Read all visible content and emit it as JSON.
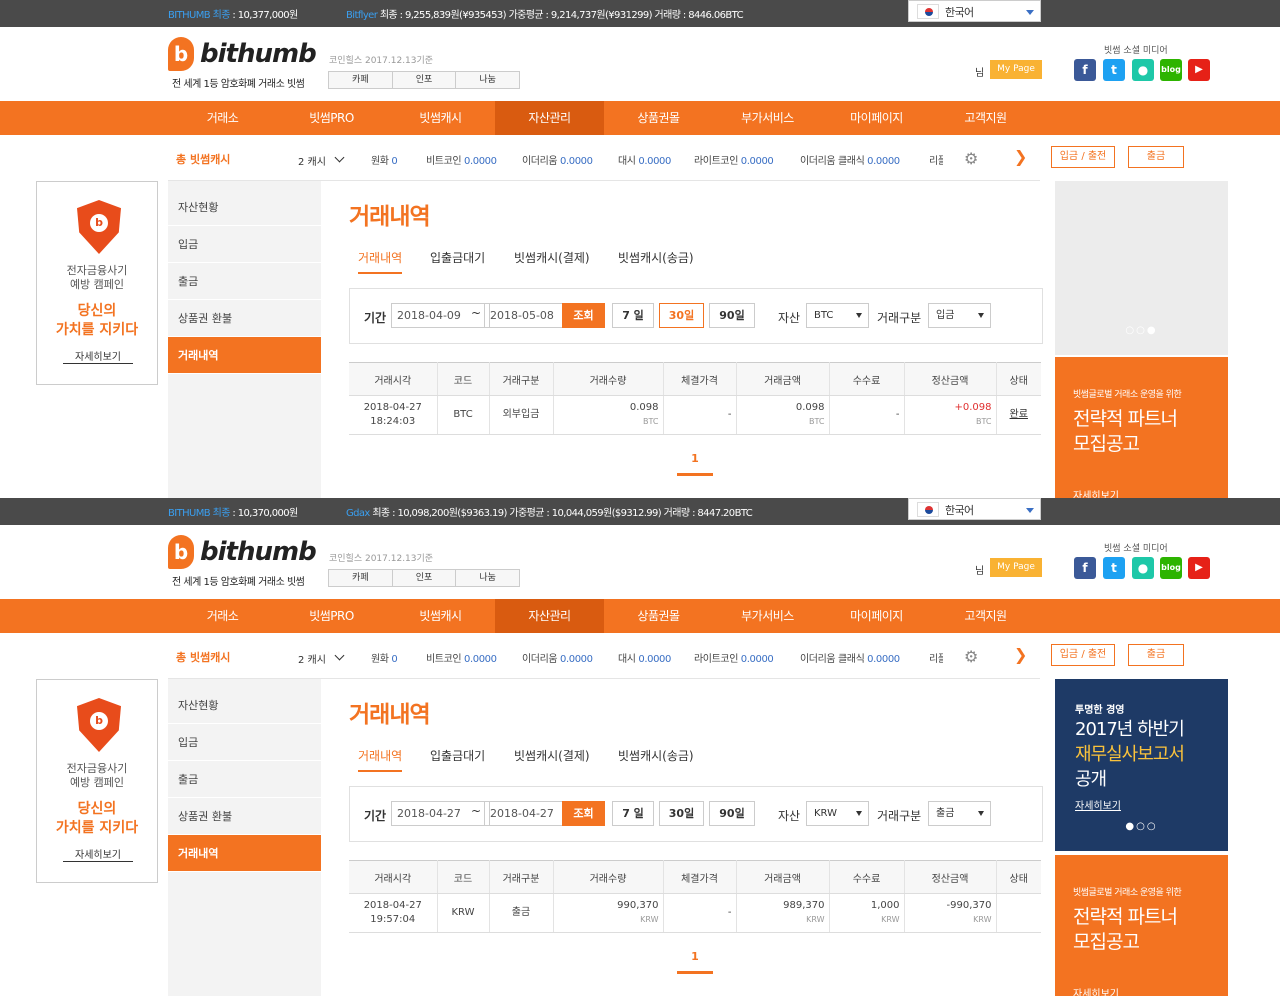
{
  "panels": [
    {
      "ticker": {
        "bithumb_label": "BITHUMB 최종",
        "bithumb_value": " : 10,377,000원",
        "exchange_label": "Bitflyer",
        "exchange_value": " 최종 : 9,255,839원(¥935453) 가중평균 : 9,214,737원(¥931299) 거래량 : 8446.06BTC"
      },
      "language": "한국어",
      "header": {
        "logo_mark": "b",
        "logo_text": "bithumb",
        "tagline": "전 세계 1등 암호화폐 거래소 빗썸",
        "coin_note": "코인힐스 2017.12.13기준",
        "small_tabs": [
          "카페",
          "인포",
          "나눔"
        ],
        "user_suffix": "님",
        "mypage": "My Page",
        "social_title": "빗썸 소셜 미디어"
      },
      "nav": [
        "거래소",
        "빗썸PRO",
        "빗썸캐시",
        "자산관리",
        "상품권몰",
        "부가서비스",
        "마이페이지",
        "고객지원"
      ],
      "subbar": {
        "total": "총 빗썸캐시",
        "cash": "2 캐시",
        "coins": [
          {
            "name": "원화",
            "val": "0"
          },
          {
            "name": "비트코인",
            "val": "0.0000"
          },
          {
            "name": "이더리움",
            "val": "0.0000"
          },
          {
            "name": "대시",
            "val": "0.0000"
          },
          {
            "name": "라이트코인",
            "val": "0.0000"
          },
          {
            "name": "이더리움 클래식",
            "val": "0.0000"
          },
          {
            "name": "리플",
            "val": ""
          }
        ],
        "deposit_btn": "입금 / 출전",
        "withdraw_btn": "출금"
      },
      "campaign": {
        "line1": "전자금융사기",
        "line2": "예방 캠페인",
        "line3": "당신의",
        "line4": "가치를 지키다",
        "more": "자세히보기"
      },
      "left_menu": [
        "자산현황",
        "입금",
        "출금",
        "상품권 환불",
        "거래내역"
      ],
      "page_title": "거래내역",
      "tabs": [
        "거래내역",
        "입출금대기",
        "빗썸캐시(결제)",
        "빗썸캐시(송금)"
      ],
      "filter": {
        "period_label": "기간",
        "date_from": "2018-04-09",
        "tilde": "~",
        "date_to": "2018-05-08",
        "search": "조회",
        "d7": "7 일",
        "d30": "30일",
        "d90": "90일",
        "asset_label": "자산",
        "asset": "BTC",
        "type_label": "거래구분",
        "type": "입금",
        "selected_range": "30일"
      },
      "table": {
        "headers": [
          "거래시각",
          "코드",
          "거래구분",
          "거래수량",
          "체결가격",
          "거래금액",
          "수수료",
          "정산금액",
          "상태"
        ],
        "row": {
          "date": "2018-04-27",
          "time": "18:24:03",
          "code": "BTC",
          "type": "외부입금",
          "qty": "0.098",
          "qty_unit": "BTC",
          "price": "-",
          "amount": "0.098",
          "amount_unit": "BTC",
          "fee": "-",
          "fee_unit": "",
          "settle": "+0.098",
          "settle_unit": "BTC",
          "status": "완료"
        }
      },
      "pager": "1",
      "banner_top": {
        "dots": "○○●"
      },
      "banner_bottom": {
        "small": "빗썸글로벌 거래소 운영을 위한",
        "line1": "전략적 파트너",
        "line2": "모집공고",
        "more": "자세히보기"
      }
    },
    {
      "ticker": {
        "bithumb_label": "BITHUMB 최종",
        "bithumb_value": " : 10,370,000원",
        "exchange_label": "Gdax",
        "exchange_value": " 최종 : 10,098,200원($9363.19) 가중평균 : 10,044,059원($9312.99) 거래량 : 8447.20BTC"
      },
      "language": "한국어",
      "header": {
        "logo_mark": "b",
        "logo_text": "bithumb",
        "tagline": "전 세계 1등 암호화폐 거래소 빗썸",
        "coin_note": "코인힐스 2017.12.13기준",
        "small_tabs": [
          "카페",
          "인포",
          "나눔"
        ],
        "user_suffix": "님",
        "mypage": "My Page",
        "social_title": "빗썸 소셜 미디어"
      },
      "nav": [
        "거래소",
        "빗썸PRO",
        "빗썸캐시",
        "자산관리",
        "상품권몰",
        "부가서비스",
        "마이페이지",
        "고객지원"
      ],
      "subbar": {
        "total": "총 빗썸캐시",
        "cash": "2 캐시",
        "coins": [
          {
            "name": "원화",
            "val": "0"
          },
          {
            "name": "비트코인",
            "val": "0.0000"
          },
          {
            "name": "이더리움",
            "val": "0.0000"
          },
          {
            "name": "대시",
            "val": "0.0000"
          },
          {
            "name": "라이트코인",
            "val": "0.0000"
          },
          {
            "name": "이더리움 클래식",
            "val": "0.0000"
          },
          {
            "name": "리플",
            "val": ""
          }
        ],
        "deposit_btn": "입금 / 출전",
        "withdraw_btn": "출금"
      },
      "campaign": {
        "line1": "전자금융사기",
        "line2": "예방 캠페인",
        "line3": "당신의",
        "line4": "가치를 지키다",
        "more": "자세히보기"
      },
      "left_menu": [
        "자산현황",
        "입금",
        "출금",
        "상품권 환불",
        "거래내역"
      ],
      "page_title": "거래내역",
      "tabs": [
        "거래내역",
        "입출금대기",
        "빗썸캐시(결제)",
        "빗썸캐시(송금)"
      ],
      "filter": {
        "period_label": "기간",
        "date_from": "2018-04-27",
        "tilde": "~",
        "date_to": "2018-04-27",
        "search": "조회",
        "d7": "7 일",
        "d30": "30일",
        "d90": "90일",
        "asset_label": "자산",
        "asset": "KRW",
        "type_label": "거래구분",
        "type": "출금",
        "selected_range": ""
      },
      "table": {
        "headers": [
          "거래시각",
          "코드",
          "거래구분",
          "거래수량",
          "체결가격",
          "거래금액",
          "수수료",
          "정산금액",
          "상태"
        ],
        "row": {
          "date": "2018-04-27",
          "time": "19:57:04",
          "code": "KRW",
          "type": "출금",
          "qty": "990,370",
          "qty_unit": "KRW",
          "price": "-",
          "amount": "989,370",
          "amount_unit": "KRW",
          "fee": "1,000",
          "fee_unit": "KRW",
          "settle": "-990,370",
          "settle_unit": "KRW",
          "status": ""
        }
      },
      "pager": "1",
      "banner_top": {
        "small": "투명한 경영",
        "line1": "2017년 하반기",
        "line2": "재무실사보고서",
        "line3": "공개",
        "more": "자세히보기",
        "dots": "●○○"
      },
      "banner_bottom": {
        "small": "빗썸글로벌 거래소 운영을 위한",
        "line1": "전략적 파트너",
        "line2": "모집공고",
        "more": "자세히보기"
      }
    }
  ],
  "colors": {
    "brand": "#f37321",
    "nav_active": "#d95b10",
    "ticker_bg": "#4a4a4a",
    "link_blue": "#3a9ff0"
  }
}
